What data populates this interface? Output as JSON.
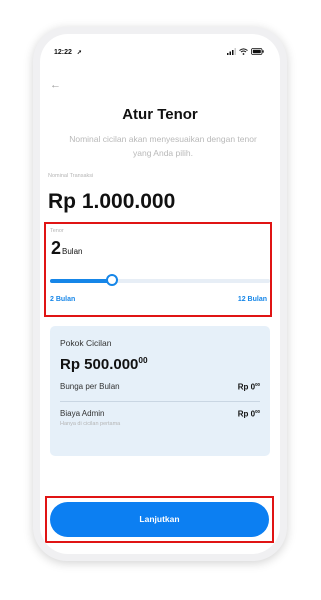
{
  "status_bar": {
    "time": "12:22",
    "location_arrow": "➚"
  },
  "header": {
    "back_icon": "←",
    "title": "Atur Tenor",
    "subtitle": "Nominal cicilan akan menyesuaikan dengan tenor yang Anda pilih."
  },
  "transaction": {
    "label": "Nominal Transaksi",
    "amount": "Rp 1.000.000"
  },
  "tenor": {
    "label": "Tenor",
    "value": "2",
    "unit": "Bulan",
    "slider": {
      "min_label": "2 Bulan",
      "max_label": "12 Bulan",
      "min": 2,
      "max": 12,
      "value": 2,
      "fill_fraction": 0.28
    }
  },
  "summary": {
    "pokok_label": "Pokok Cicilan",
    "pokok_value": "Rp 500.000",
    "pokok_cents": "00",
    "bunga_label": "Bunga per Bulan",
    "bunga_value": "Rp 0",
    "bunga_cents": "00",
    "admin_label": "Biaya Admin",
    "admin_value": "Rp 0",
    "admin_cents": "00",
    "admin_note": "Hanya di cicilan pertama"
  },
  "cta": {
    "label": "Lanjutkan"
  },
  "colors": {
    "accent": "#1686e8",
    "button": "#0c7ff2",
    "highlight_border": "#e01414",
    "summary_bg": "#e6f0f9"
  }
}
